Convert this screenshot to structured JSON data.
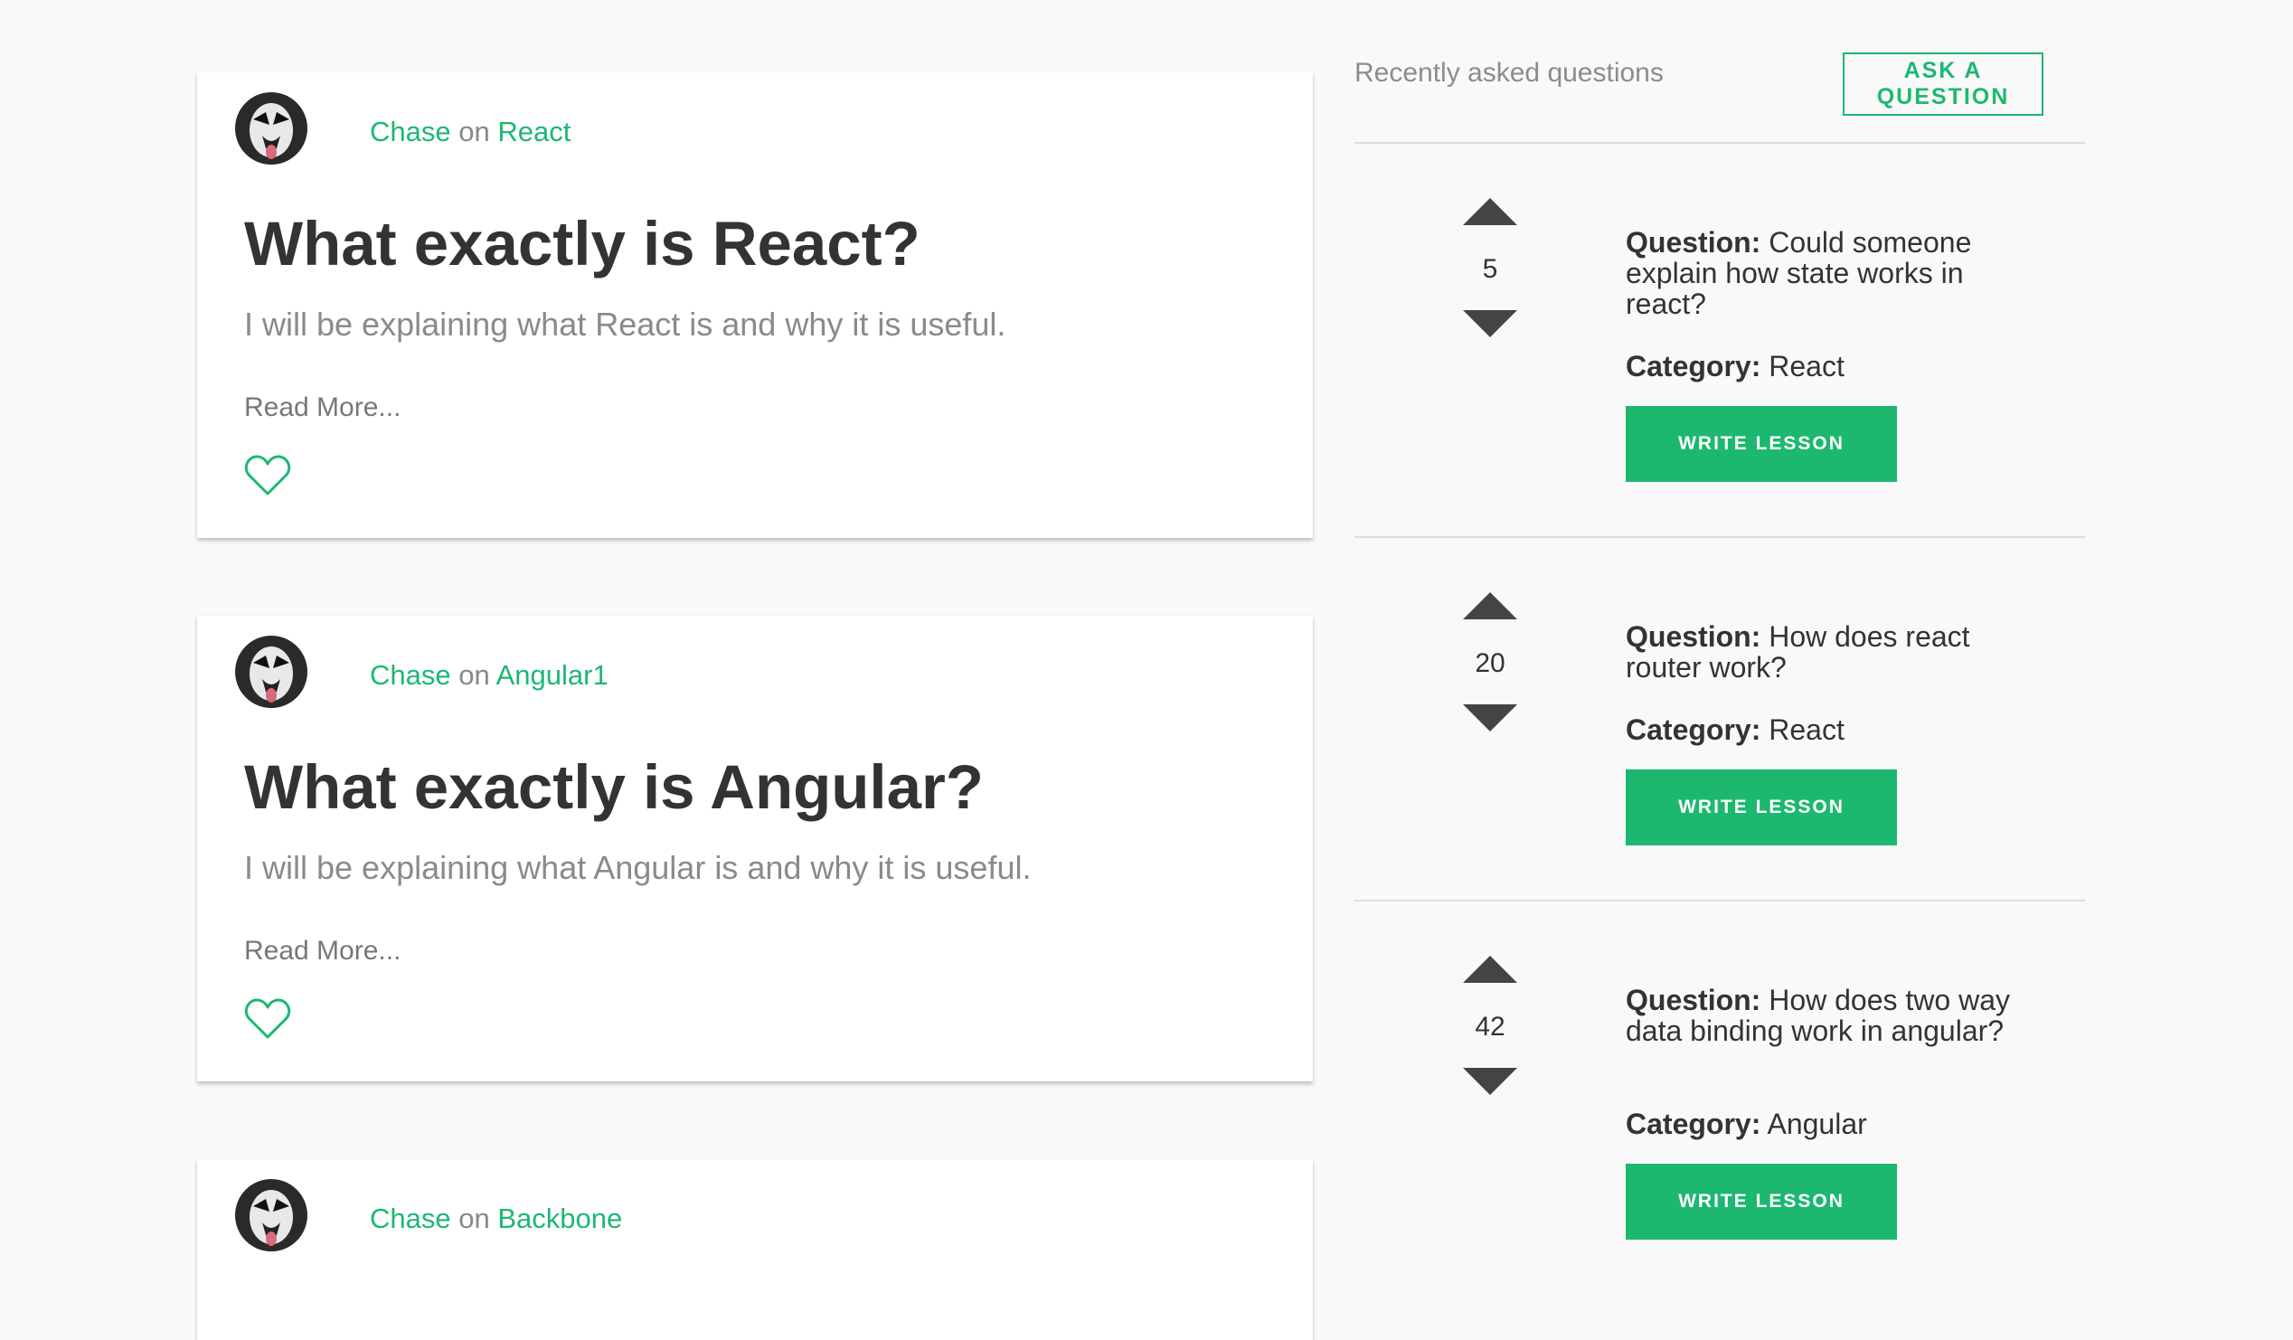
{
  "lessons": [
    {
      "author": "Chase",
      "on_word": "on",
      "topic": "React",
      "title": "What exactly is React?",
      "description": "I will be explaining what React is and why it is useful.",
      "read_more": "Read More..."
    },
    {
      "author": "Chase",
      "on_word": "on",
      "topic": "Angular1",
      "title": "What exactly is Angular?",
      "description": "I will be explaining what Angular is and why it is useful.",
      "read_more": "Read More..."
    },
    {
      "author": "Chase",
      "on_word": "on",
      "topic": "Backbone"
    }
  ],
  "sidebar": {
    "heading": "Recently asked questions",
    "ask_button": "ASK A QUESTION",
    "questions": [
      {
        "votes": "5",
        "question_label": "Question:",
        "question": "Could someone explain how state works in react?",
        "category_label": "Category:",
        "category": "React",
        "button": "WRITE LESSON"
      },
      {
        "votes": "20",
        "question_label": "Question:",
        "question": "How does react router work?",
        "category_label": "Category:",
        "category": "React",
        "button": "WRITE LESSON"
      },
      {
        "votes": "42",
        "question_label": "Question:",
        "question": "How does two way data binding work in angular?",
        "category_label": "Category:",
        "category": "Angular",
        "button": "WRITE LESSON"
      }
    ]
  },
  "colors": {
    "accent": "#1db870",
    "background": "#f9f9f9",
    "title_text": "#333333",
    "muted_text": "#8a8a8a",
    "vote_arrow": "#444444"
  },
  "icons": [
    "avatar-image",
    "heart-icon",
    "upvote-arrow-icon",
    "downvote-arrow-icon"
  ]
}
